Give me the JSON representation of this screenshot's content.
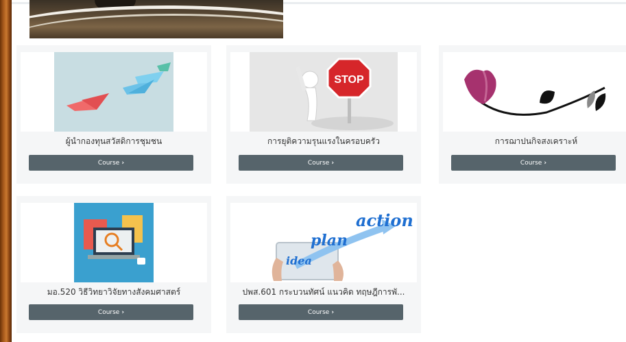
{
  "courses": [
    {
      "title": "ผู้นำกองทุนสวัสดิการชุมชน",
      "button": "Course",
      "image": "paper-boats"
    },
    {
      "title": "การยุติความรุนแรงในครอบครัว",
      "button": "Course",
      "image": "stop-sign"
    },
    {
      "title": "การฌาปนกิจสงเคราะห์",
      "button": "Course",
      "image": "flower-vine"
    },
    {
      "title": "มอ.520 วิธีวิทยาวิจัยทางสังคมศาสตร์",
      "button": "Course",
      "image": "research-laptop"
    },
    {
      "title": "ปพส.601 กระบวนทัศน์ แนวคิด ทฤษฎีการพั...",
      "button": "Course",
      "image": "idea-plan-action"
    }
  ],
  "action_image": {
    "word1": "idea",
    "word2": "plan",
    "word3": "action"
  },
  "stop_text": "STOP",
  "colors": {
    "button": "#56646b",
    "card_bg": "#f5f6f7",
    "accent_blue": "#1f6fd1"
  }
}
